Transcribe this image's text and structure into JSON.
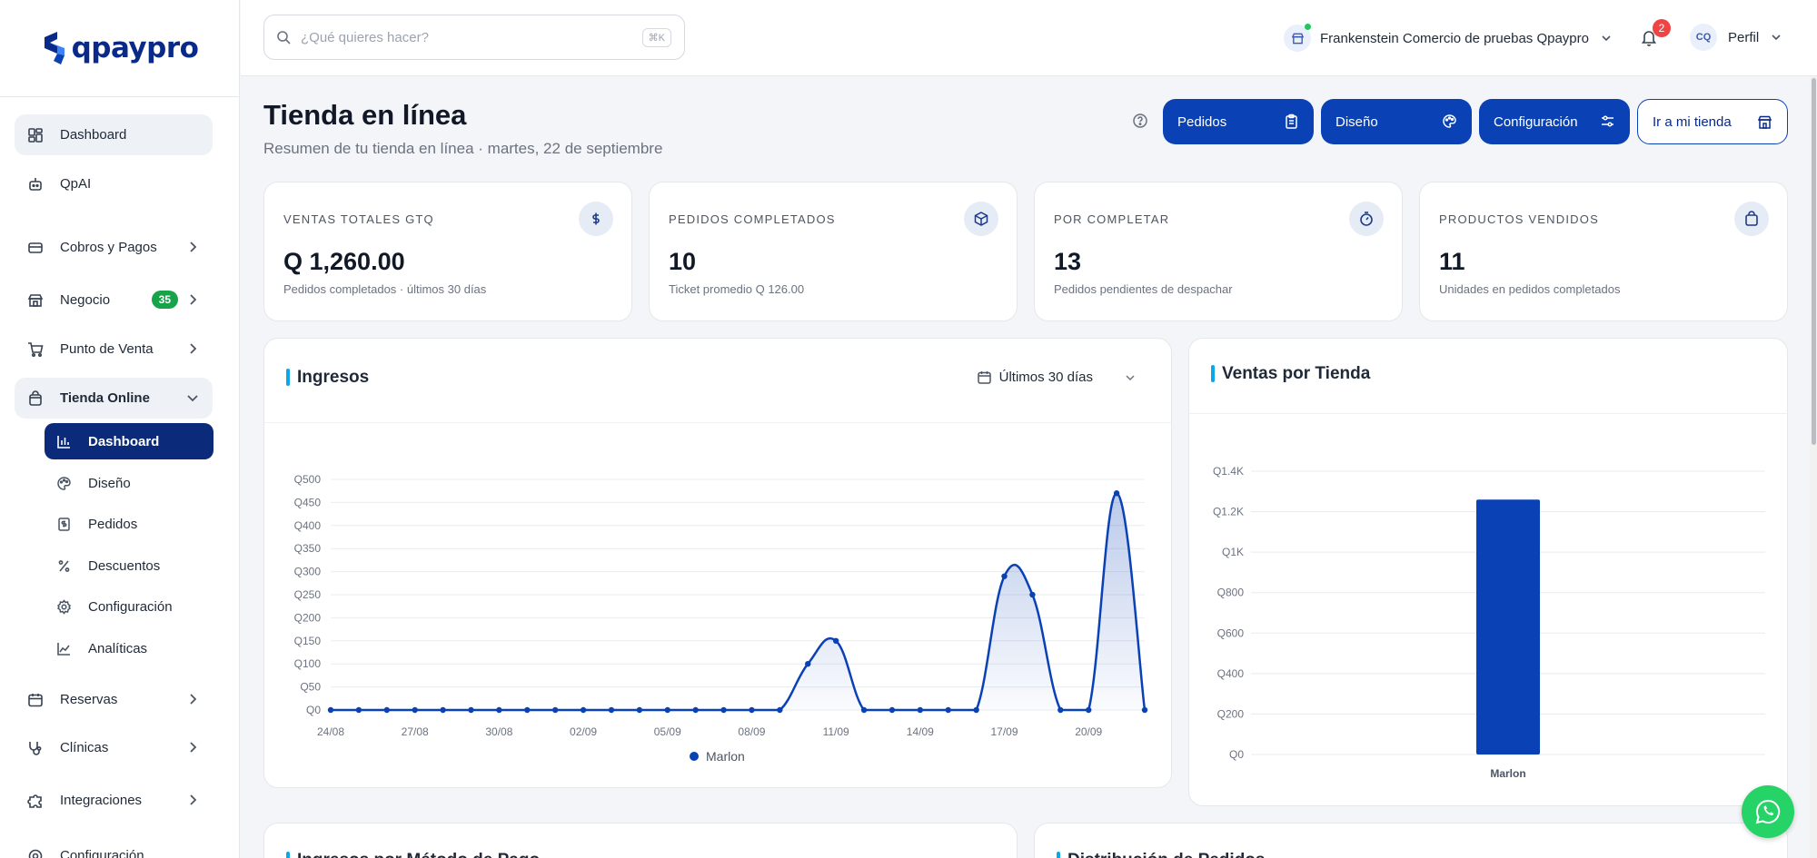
{
  "brand": {
    "name": "qpaypro"
  },
  "sidebar": {
    "items": [
      {
        "label": "Dashboard",
        "icon": "dashboard-icon"
      },
      {
        "label": "QpAI",
        "icon": "robot-icon"
      },
      {
        "label": "Cobros y Pagos",
        "icon": "wallet-icon"
      },
      {
        "label": "Negocio",
        "icon": "store-icon",
        "badge": "35"
      },
      {
        "label": "Punto de Venta",
        "icon": "cart-icon"
      },
      {
        "label": "Tienda Online",
        "icon": "shopping-bag-icon"
      },
      {
        "label": "Reservas",
        "icon": "calendar-icon"
      },
      {
        "label": "Clínicas",
        "icon": "stethoscope-icon"
      },
      {
        "label": "Integraciones",
        "icon": "puzzle-icon"
      },
      {
        "label": "Configuración",
        "icon": "gear-icon"
      }
    ],
    "sub_items": [
      {
        "label": "Dashboard",
        "icon": "bar-chart-icon"
      },
      {
        "label": "Diseño",
        "icon": "palette-icon"
      },
      {
        "label": "Pedidos",
        "icon": "receipt-icon"
      },
      {
        "label": "Descuentos",
        "icon": "percent-icon"
      },
      {
        "label": "Configuración",
        "icon": "gear-icon"
      },
      {
        "label": "Analíticas",
        "icon": "line-chart-icon"
      }
    ]
  },
  "topbar": {
    "search_placeholder": "¿Qué quieres hacer?",
    "search_shortcut": "⌘K",
    "store_name": "Frankenstein Comercio de pruebas Qpaypro",
    "notification_count": "2",
    "avatar_initials": "CQ",
    "profile_label": "Perfil"
  },
  "page": {
    "title": "Tienda en línea",
    "subtitle": "Resumen de tu tienda en línea · martes, 22 de septiembre",
    "buttons": {
      "orders": "Pedidos",
      "design": "Diseño",
      "config": "Configuración",
      "store": "Ir a mi tienda"
    }
  },
  "stats": [
    {
      "label": "VENTAS TOTALES GTQ",
      "value": "Q 1,260.00",
      "note": "Pedidos completados · últimos 30 días",
      "icon": "dollar-icon"
    },
    {
      "label": "PEDIDOS COMPLETADOS",
      "value": "10",
      "note": "Ticket promedio Q 126.00",
      "icon": "box-icon"
    },
    {
      "label": "POR COMPLETAR",
      "value": "13",
      "note": "Pedidos pendientes de despachar",
      "icon": "timer-icon"
    },
    {
      "label": "PRODUCTOS VENDIDOS",
      "value": "11",
      "note": "Unidades en pedidos completados",
      "icon": "shopping-bag-icon"
    }
  ],
  "panels": {
    "ingresos_title": "Ingresos",
    "range_label": "Últimos 30 días",
    "ventas_title": "Ventas por Tienda",
    "metodo_title": "Ingresos por Método de Pago",
    "distribucion_title": "Distribución de Pedidos"
  },
  "colors": {
    "primary": "#0a41b5",
    "navy": "#0b2b7a",
    "accent": "#0ea5e9",
    "badge_green": "#16a34a",
    "alert": "#ef4444"
  },
  "chart_data": [
    {
      "type": "area",
      "title": "Ingresos",
      "x_tick_labels": [
        "24/08",
        "27/08",
        "30/08",
        "02/09",
        "05/09",
        "08/09",
        "11/09",
        "14/09",
        "17/09",
        "20/09"
      ],
      "y_tick_labels": [
        "Q0",
        "Q50",
        "Q100",
        "Q150",
        "Q200",
        "Q250",
        "Q300",
        "Q350",
        "Q400",
        "Q450",
        "Q500"
      ],
      "ylim": [
        0,
        500
      ],
      "x_start": "24/08",
      "series": [
        {
          "name": "Marlon",
          "values": [
            0,
            0,
            0,
            0,
            0,
            0,
            0,
            0,
            0,
            0,
            0,
            0,
            0,
            0,
            0,
            0,
            0,
            100,
            150,
            0,
            0,
            0,
            0,
            0,
            290,
            250,
            0,
            0,
            470,
            0
          ]
        }
      ],
      "legend": "bottom-center",
      "grid": true
    },
    {
      "type": "bar",
      "title": "Ventas por Tienda",
      "categories": [
        "Marlon"
      ],
      "values": [
        1260
      ],
      "y_tick_labels": [
        "Q0",
        "Q200",
        "Q400",
        "Q600",
        "Q800",
        "Q1K",
        "Q1.2K",
        "Q1.4K"
      ],
      "ylim": [
        0,
        1400
      ],
      "grid": true
    }
  ]
}
